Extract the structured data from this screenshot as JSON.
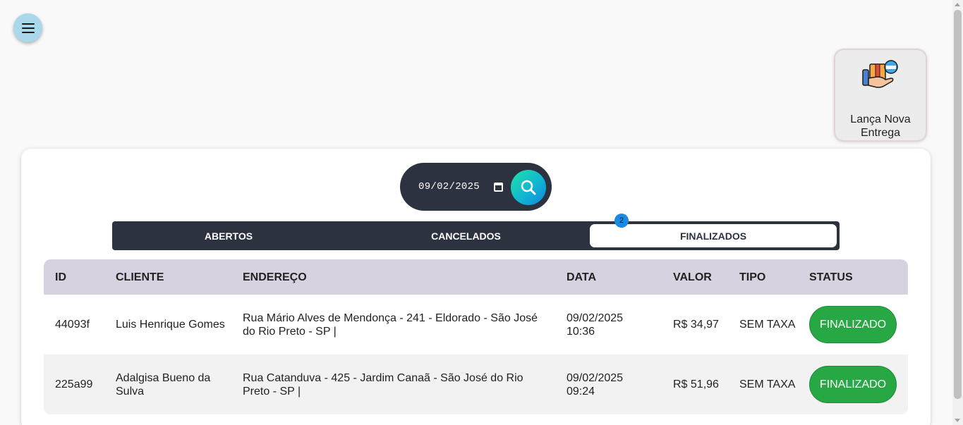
{
  "menu": {
    "icon": "hamburger-menu-icon"
  },
  "new_delivery": {
    "label": "Lança Nova Entrega",
    "icon": "new-delivery-package-icon"
  },
  "search": {
    "date_value": "09/02/2025",
    "icon": "search-icon"
  },
  "tabs": [
    {
      "label": "ABERTOS"
    },
    {
      "label": "CANCELADOS"
    },
    {
      "label": "FINALIZADOS",
      "badge": "2",
      "active": true
    }
  ],
  "table": {
    "headers": [
      "ID",
      "CLIENTE",
      "ENDEREÇO",
      "DATA",
      "VALOR",
      "TIPO",
      "STATUS"
    ],
    "rows": [
      {
        "id": "44093f",
        "cliente": "Luis Henrique Gomes",
        "endereco": "Rua Mário Alves de Mendonça - 241 - Eldorado - São José do Rio Preto - SP |",
        "data": "09/02/2025 10:36",
        "valor": "R$ 34,97",
        "tipo": "SEM TAXA",
        "status": "FINALIZADO"
      },
      {
        "id": "225a99",
        "cliente": "Adalgisa Bueno da Sulva",
        "endereco": "Rua Catanduva - 425 - Jardim Canaã - São José do Rio Preto - SP |",
        "data": "09/02/2025 09:24",
        "valor": "R$ 51,96",
        "tipo": "SEM TAXA",
        "status": "FINALIZADO"
      }
    ]
  },
  "colors": {
    "dark": "#2c323f",
    "header": "#d6d2e0",
    "status_green": "#28a745",
    "badge_blue": "#1a8ae5",
    "menu_btn": "#a9d8ea"
  }
}
